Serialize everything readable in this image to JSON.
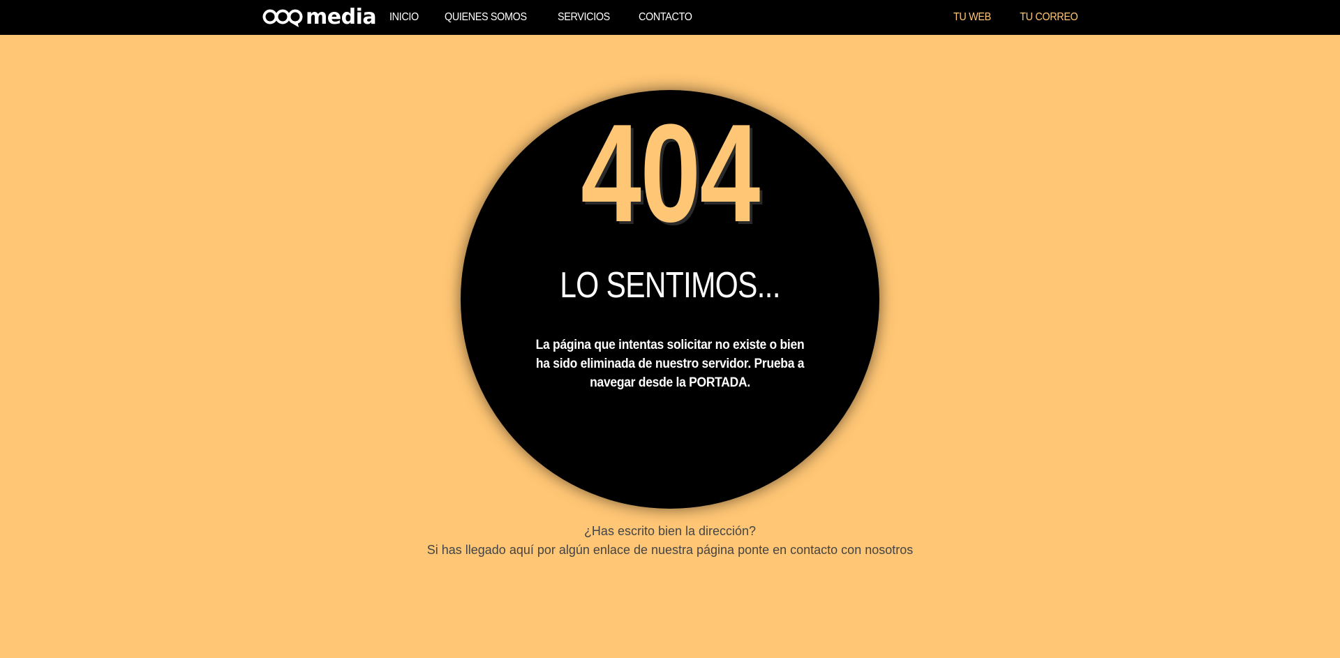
{
  "header": {
    "brand": "media",
    "nav_left": [
      "INICIO",
      "QUIENES SOMOS",
      "SERVICIOS",
      "CONTACTO"
    ],
    "nav_right": [
      "TU WEB",
      "TU CORREO"
    ]
  },
  "error": {
    "code": "404",
    "title": "LO SENTIMOS...",
    "message": "La página que intentas solicitar no existe o bien ha sido eliminada de nuestro servidor. Prueba a navegar desde la PORTADA."
  },
  "footer": {
    "line1": "¿Has escrito bien la dirección?",
    "line2": "Si has llegado aquí por algún enlace de nuestra página ponte en contacto con nosotros"
  },
  "colors": {
    "background": "#ffc675",
    "bar": "#000000",
    "accent": "#ffc675",
    "text_dark": "#444444"
  },
  "icons": {
    "logo": "speech-bubbles-logo-icon"
  }
}
